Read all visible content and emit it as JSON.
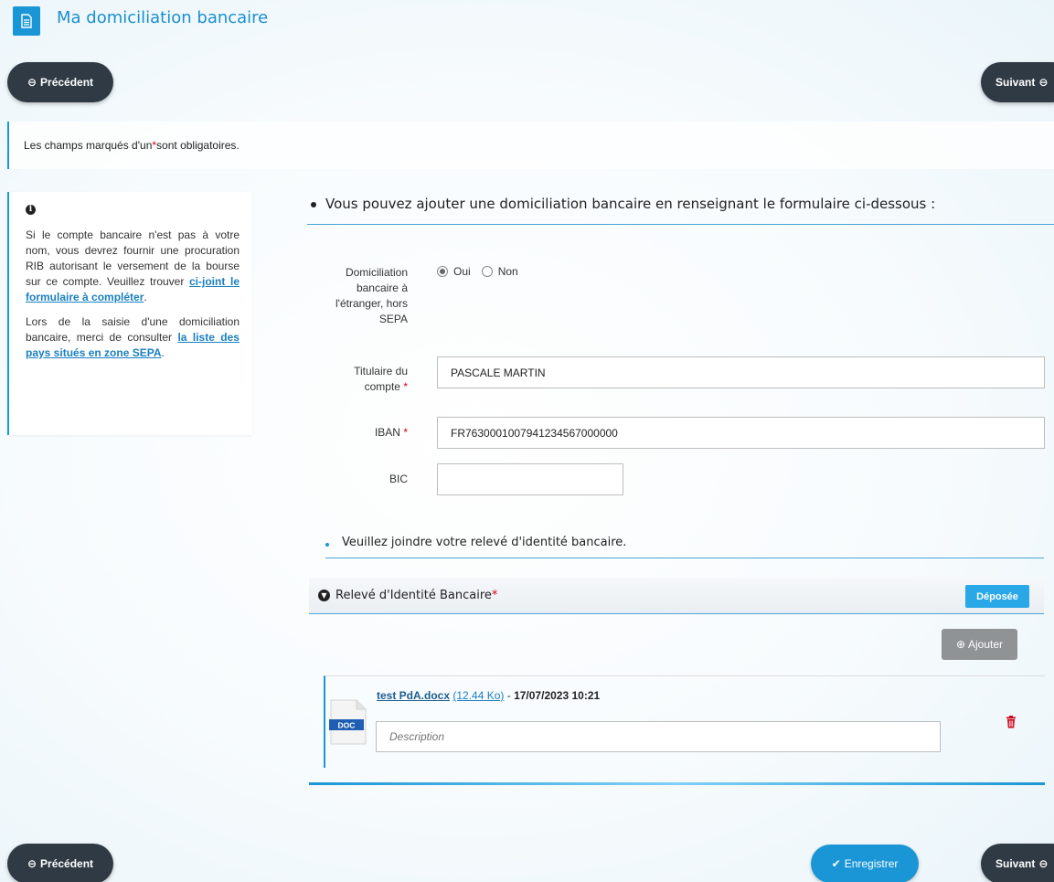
{
  "header": {
    "title": "Ma domiciliation bancaire",
    "icon": "document-icon",
    "accent_color": "#1a96d6"
  },
  "nav": {
    "prev_label": "Précédent",
    "next_label": "Suivant",
    "save_label": "Enregistrer"
  },
  "notice": {
    "before_star": "Les champs marqués d'un ",
    "star": "*",
    "after_star": " sont obligatoires."
  },
  "info": {
    "icon": "info-icon",
    "p1_text": "Si le compte bancaire n'est pas à votre nom, vous devrez fournir une procuration RIB autorisant le versement de la bourse sur ce compte. Veuillez trouver ",
    "p1_link": "ci-joint le formulaire à compléter",
    "p1_end": ".",
    "p2_text": "Lors de la saisie d'une domiciliation bancaire, merci de consulter ",
    "p2_link": "la liste des pays situés en zone SEPA",
    "p2_end": "."
  },
  "form": {
    "heading": "Vous pouvez ajouter une domiciliation bancaire en renseignant le formulaire ci-dessous :",
    "foreign_label": "Domiciliation bancaire à l'étranger, hors SEPA",
    "foreign_options": [
      "Oui",
      "Non"
    ],
    "foreign_selected": "Oui",
    "holder_label": "Titulaire du compte",
    "holder_value": "PASCALE MARTIN",
    "iban_label": "IBAN",
    "iban_value": "FR7630001007941234567000000",
    "bic_label": "BIC",
    "bic_value": "",
    "required_star": "*"
  },
  "attachments": {
    "instruction": "Veuillez joindre votre relevé d'identité bancaire.",
    "section_title": "Relevé d'Identité Bancaire",
    "required_star": "*",
    "status": "Déposée",
    "add_label": "Ajouter",
    "file": {
      "name": "test PdA.docx",
      "size": "(12.44 Ko)",
      "separator": " - ",
      "date": "17/07/2023 10:21",
      "type_badge": "DOC",
      "description_placeholder": "Description"
    }
  }
}
